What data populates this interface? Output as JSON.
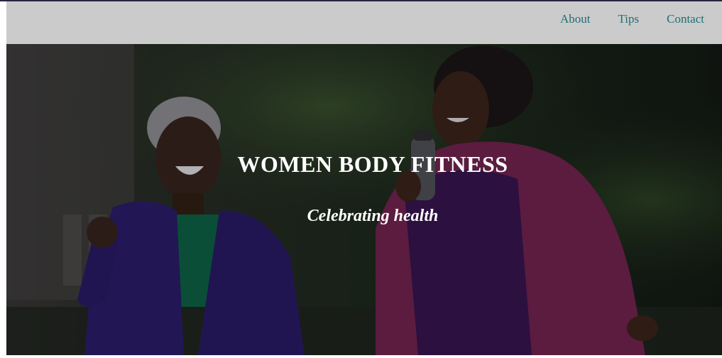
{
  "nav": {
    "items": [
      {
        "label": "About"
      },
      {
        "label": "Tips"
      },
      {
        "label": "Contact"
      }
    ]
  },
  "hero": {
    "title": "WOMEN BODY FITNESS",
    "subtitle": "Celebrating health",
    "image_icon": "photo-two-women-jogging"
  },
  "colors": {
    "navbar_bg": "#cbcbcb",
    "nav_link": "#1f6f75",
    "hero_text": "#ffffff"
  }
}
